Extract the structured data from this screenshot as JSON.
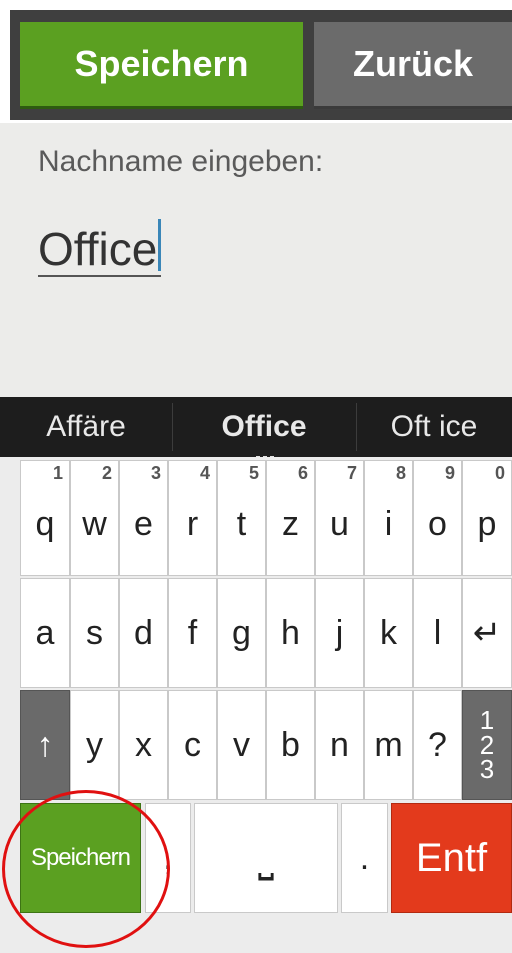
{
  "header": {
    "save_label": "Speichern",
    "back_label": "Zurück"
  },
  "form": {
    "prompt": "Nachname eingeben:",
    "value": "Office"
  },
  "suggestions": [
    "Affäre",
    "Office",
    "Oft ice"
  ],
  "keyboard": {
    "row1": [
      {
        "letter": "q",
        "num": "1"
      },
      {
        "letter": "w",
        "num": "2"
      },
      {
        "letter": "e",
        "num": "3"
      },
      {
        "letter": "r",
        "num": "4"
      },
      {
        "letter": "t",
        "num": "5"
      },
      {
        "letter": "z",
        "num": "6"
      },
      {
        "letter": "u",
        "num": "7"
      },
      {
        "letter": "i",
        "num": "8"
      },
      {
        "letter": "o",
        "num": "9"
      },
      {
        "letter": "p",
        "num": "0"
      }
    ],
    "row2": [
      "a",
      "s",
      "d",
      "f",
      "g",
      "h",
      "j",
      "k",
      "l"
    ],
    "enter_glyph": "↵",
    "shift_glyph": "↑",
    "row3": [
      "y",
      "x",
      "c",
      "v",
      "b",
      "n",
      "m",
      "?"
    ],
    "numbers_key": [
      "1",
      "2",
      "3"
    ],
    "save_label": "Speichern",
    "comma": ",",
    "space_glyph": "⎵",
    "period": ".",
    "delete_label": "Entf"
  },
  "colors": {
    "save_green": "#5ba021",
    "delete_red": "#e33a1c",
    "annotation_red": "#e01010"
  },
  "icons": {
    "enter": "enter-icon",
    "shift": "shift-icon",
    "space": "space-bar-icon"
  }
}
